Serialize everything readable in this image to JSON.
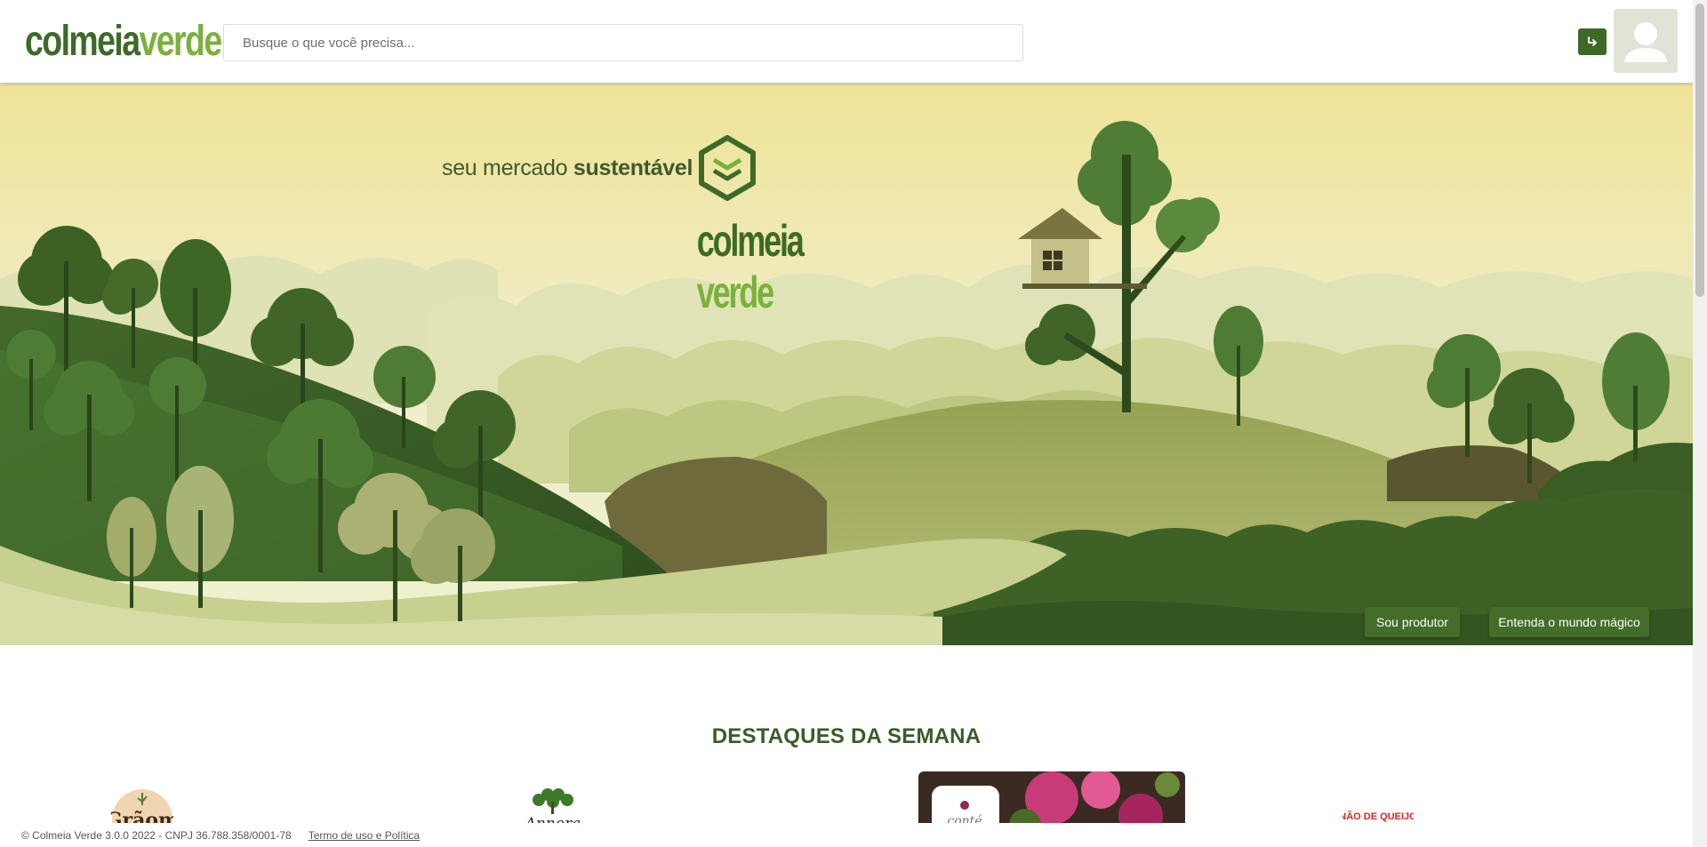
{
  "header": {
    "logo": {
      "word1": "colmeia",
      "word2": "verde"
    },
    "search": {
      "placeholder": "Busque o que você precisa..."
    },
    "login_icon": "login-arrow-icon",
    "avatar_icon": "user-avatar-icon"
  },
  "hero": {
    "tagline_prefix": "seu mercado",
    "tagline_bold": "sustentável",
    "logo_line1": "colmeia",
    "logo_line2": "verde",
    "buttons": {
      "producer": "Sou produtor",
      "magic": "Entenda o mundo mágico"
    }
  },
  "highlights": {
    "title_bold": "DESTAQUES",
    "title_rest": "DA SEMANA",
    "brands": [
      "Grãom",
      "Annora",
      "conté",
      "NÃO DE QUEIJO"
    ]
  },
  "footer": {
    "copyright": "© Colmeia Verde 3.0.0 2022 - CNPJ 36.788.358/0001-78",
    "terms": "Termo de uso e Política"
  },
  "colors": {
    "brand_dark": "#3d6a27",
    "brand_light": "#7ab13a",
    "button_green": "#436d28",
    "sky_top": "#eee397",
    "sky_bottom": "#f1eecb"
  }
}
